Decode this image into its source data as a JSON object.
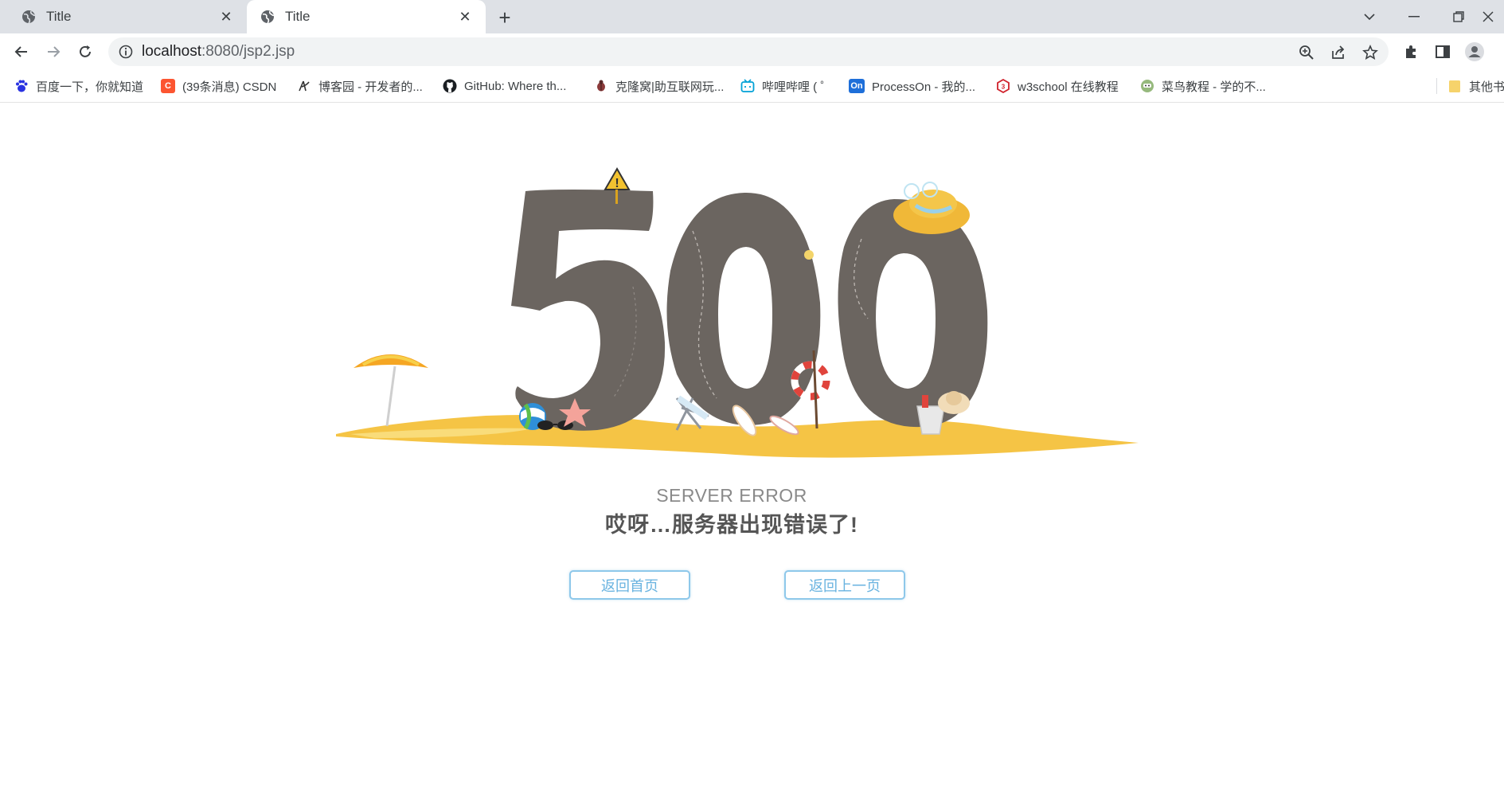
{
  "tabs": [
    {
      "title": "Title",
      "active": false
    },
    {
      "title": "Title",
      "active": true
    }
  ],
  "address_bar": {
    "host": "localhost",
    "path": ":8080/jsp2.jsp"
  },
  "bookmarks": [
    {
      "label": "百度一下，你就知道",
      "icon": "baidu-paw-icon",
      "color": "#2932e1"
    },
    {
      "label": "(39条消息) CSDN",
      "icon": "csdn-icon",
      "color": "#fc5531"
    },
    {
      "label": "博客园 - 开发者的...",
      "icon": "cnblogs-icon",
      "color": "#333333"
    },
    {
      "label": "GitHub: Where th...",
      "icon": "github-icon",
      "color": "#1b1f23"
    },
    {
      "label": "克隆窝|助互联网玩...",
      "icon": "bug-icon",
      "color": "#8b3a3a"
    },
    {
      "label": "哔哩哔哩 ( ゜",
      "icon": "bilibili-tv-icon",
      "color": "#00a1d6"
    },
    {
      "label": "ProcessOn - 我的...",
      "icon": "processon-icon",
      "color": "#1e6fd9",
      "badge": "On"
    },
    {
      "label": "w3school 在线教程",
      "icon": "w3school-icon",
      "color": "#d0212b"
    },
    {
      "label": "菜鸟教程 - 学的不...",
      "icon": "runoob-icon",
      "color": "#96b97d"
    },
    {
      "label": "其他书",
      "icon": "folder-icon",
      "color": "#f6d36b"
    }
  ],
  "page": {
    "big_number": "500",
    "error_title": "SERVER ERROR",
    "error_message": "哎呀…服务器出现错误了!",
    "home_button": "返回首页",
    "back_button": "返回上一页"
  },
  "colors": {
    "digit": "#6b6560",
    "sand": "#f5c445",
    "button_border": "#8ec8ea",
    "button_text": "#69b3e0"
  }
}
